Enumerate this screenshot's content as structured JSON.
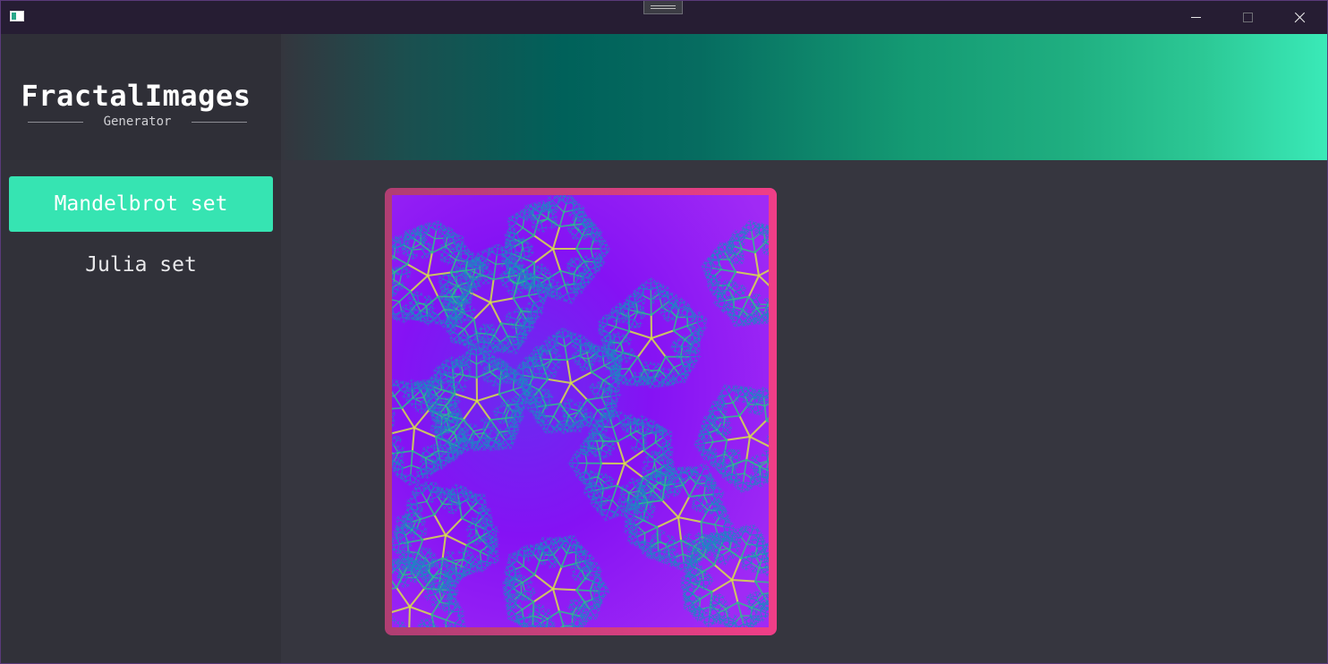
{
  "window": {
    "colors": {
      "titlebar": "#261d33",
      "sidebar": "#313139",
      "main_background": "#36363f",
      "accent": "#36e4b2",
      "frame_border": "#f03e87",
      "fractal_base": "#8f10f2"
    }
  },
  "titlebar": {
    "icons": {
      "app": "app-window-icon",
      "drag": "drag-handle-icon",
      "minimize": "minimize-icon",
      "maximize": "maximize-icon",
      "close": "close-icon"
    }
  },
  "logo": {
    "title": "FractalImages",
    "subtitle": "Generator"
  },
  "sidebar": {
    "items": [
      {
        "label": "Mandelbrot set",
        "active": true
      },
      {
        "label": "Julia set",
        "active": false
      }
    ]
  },
  "main": {
    "image": {
      "name": "julia-set-fractal",
      "palette": [
        "#8f10f2",
        "#5b2bf0",
        "#1f86c4",
        "#2fbf8a",
        "#d7e04a"
      ]
    }
  }
}
